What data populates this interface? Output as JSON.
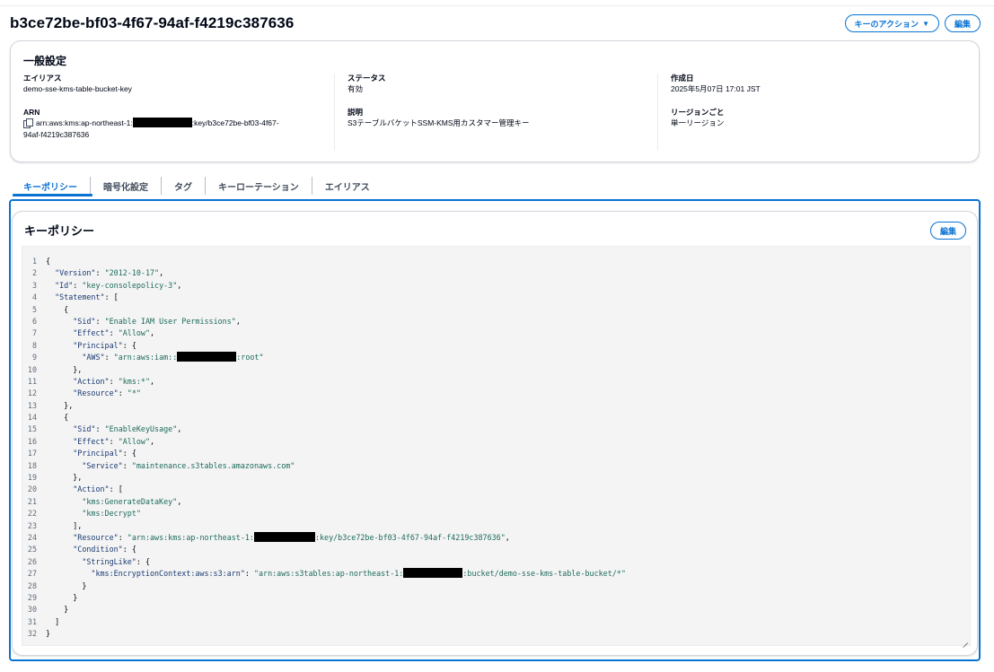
{
  "header": {
    "title": "b3ce72be-bf03-4f67-94af-f4219c387636",
    "key_actions_label": "キーのアクション",
    "edit_label": "編集"
  },
  "general": {
    "title": "一般設定",
    "alias_label": "エイリアス",
    "alias_value": "demo-sse-kms-table-bucket-key",
    "arn_label": "ARN",
    "arn_prefix": "arn:aws:kms:ap-northeast-1:",
    "arn_suffix": ":key/b3ce72be-bf03-4f67-",
    "arn_line2": "94af-f4219c387636",
    "status_label": "ステータス",
    "status_value": "有効",
    "description_label": "説明",
    "description_value": "S3テーブルバケットSSM-KMS用カスタマー管理キー",
    "created_label": "作成日",
    "created_value": "2025年5月07日 17:01 JST",
    "region_label": "リージョンごと",
    "region_value": "単一リージョン"
  },
  "tabs": [
    {
      "label": "キーポリシー",
      "active": true
    },
    {
      "label": "暗号化設定",
      "active": false
    },
    {
      "label": "タグ",
      "active": false
    },
    {
      "label": "キーローテーション",
      "active": false
    },
    {
      "label": "エイリアス",
      "active": false
    }
  ],
  "policy": {
    "title": "キーポリシー",
    "edit_label": "編集",
    "lines": [
      {
        "n": "1",
        "parts": [
          [
            "p",
            "{"
          ]
        ]
      },
      {
        "n": "2",
        "parts": [
          [
            "p",
            "  "
          ],
          [
            "k",
            "\"Version\""
          ],
          [
            "p",
            ": "
          ],
          [
            "s",
            "\"2012-10-17\""
          ],
          [
            "p",
            ","
          ]
        ]
      },
      {
        "n": "3",
        "parts": [
          [
            "p",
            "  "
          ],
          [
            "k",
            "\"Id\""
          ],
          [
            "p",
            ": "
          ],
          [
            "s",
            "\"key-consolepolicy-3\""
          ],
          [
            "p",
            ","
          ]
        ]
      },
      {
        "n": "4",
        "parts": [
          [
            "p",
            "  "
          ],
          [
            "k",
            "\"Statement\""
          ],
          [
            "p",
            ": ["
          ]
        ]
      },
      {
        "n": "5",
        "parts": [
          [
            "p",
            "    {"
          ]
        ]
      },
      {
        "n": "6",
        "parts": [
          [
            "p",
            "      "
          ],
          [
            "k",
            "\"Sid\""
          ],
          [
            "p",
            ": "
          ],
          [
            "s",
            "\"Enable IAM User Permissions\""
          ],
          [
            "p",
            ","
          ]
        ]
      },
      {
        "n": "7",
        "parts": [
          [
            "p",
            "      "
          ],
          [
            "k",
            "\"Effect\""
          ],
          [
            "p",
            ": "
          ],
          [
            "s",
            "\"Allow\""
          ],
          [
            "p",
            ","
          ]
        ]
      },
      {
        "n": "8",
        "parts": [
          [
            "p",
            "      "
          ],
          [
            "k",
            "\"Principal\""
          ],
          [
            "p",
            ": {"
          ]
        ]
      },
      {
        "n": "9",
        "parts": [
          [
            "p",
            "        "
          ],
          [
            "k",
            "\"AWS\""
          ],
          [
            "p",
            ": "
          ],
          [
            "s",
            "\"arn:aws:iam::"
          ],
          [
            "r",
            "11"
          ],
          [
            "s",
            ":root\""
          ]
        ]
      },
      {
        "n": "10",
        "parts": [
          [
            "p",
            "      },"
          ]
        ]
      },
      {
        "n": "11",
        "parts": [
          [
            "p",
            "      "
          ],
          [
            "k",
            "\"Action\""
          ],
          [
            "p",
            ": "
          ],
          [
            "s",
            "\"kms:*\""
          ],
          [
            "p",
            ","
          ]
        ]
      },
      {
        "n": "12",
        "parts": [
          [
            "p",
            "      "
          ],
          [
            "k",
            "\"Resource\""
          ],
          [
            "p",
            ": "
          ],
          [
            "s",
            "\"*\""
          ]
        ]
      },
      {
        "n": "13",
        "parts": [
          [
            "p",
            "    },"
          ]
        ]
      },
      {
        "n": "14",
        "parts": [
          [
            "p",
            "    {"
          ]
        ]
      },
      {
        "n": "15",
        "parts": [
          [
            "p",
            "      "
          ],
          [
            "k",
            "\"Sid\""
          ],
          [
            "p",
            ": "
          ],
          [
            "s",
            "\"EnableKeyUsage\""
          ],
          [
            "p",
            ","
          ]
        ]
      },
      {
        "n": "16",
        "parts": [
          [
            "p",
            "      "
          ],
          [
            "k",
            "\"Effect\""
          ],
          [
            "p",
            ": "
          ],
          [
            "s",
            "\"Allow\""
          ],
          [
            "p",
            ","
          ]
        ]
      },
      {
        "n": "17",
        "parts": [
          [
            "p",
            "      "
          ],
          [
            "k",
            "\"Principal\""
          ],
          [
            "p",
            ": {"
          ]
        ]
      },
      {
        "n": "18",
        "parts": [
          [
            "p",
            "        "
          ],
          [
            "k",
            "\"Service\""
          ],
          [
            "p",
            ": "
          ],
          [
            "s",
            "\"maintenance.s3tables.amazonaws.com\""
          ]
        ]
      },
      {
        "n": "19",
        "parts": [
          [
            "p",
            "      },"
          ]
        ]
      },
      {
        "n": "20",
        "parts": [
          [
            "p",
            "      "
          ],
          [
            "k",
            "\"Action\""
          ],
          [
            "p",
            ": ["
          ]
        ]
      },
      {
        "n": "21",
        "parts": [
          [
            "p",
            "        "
          ],
          [
            "s",
            "\"kms:GenerateDataKey\""
          ],
          [
            "p",
            ","
          ]
        ]
      },
      {
        "n": "22",
        "parts": [
          [
            "p",
            "        "
          ],
          [
            "s",
            "\"kms:Decrypt\""
          ]
        ]
      },
      {
        "n": "23",
        "parts": [
          [
            "p",
            "      ],"
          ]
        ]
      },
      {
        "n": "24",
        "parts": [
          [
            "p",
            "      "
          ],
          [
            "k",
            "\"Resource\""
          ],
          [
            "p",
            ": "
          ],
          [
            "s",
            "\"arn:aws:kms:ap-northeast-1:"
          ],
          [
            "r",
            "11"
          ],
          [
            "s",
            ":key/b3ce72be-bf03-4f67-94af-f4219c387636\""
          ],
          [
            "p",
            ","
          ]
        ]
      },
      {
        "n": "25",
        "parts": [
          [
            "p",
            "      "
          ],
          [
            "k",
            "\"Condition\""
          ],
          [
            "p",
            ": {"
          ]
        ]
      },
      {
        "n": "26",
        "parts": [
          [
            "p",
            "        "
          ],
          [
            "k",
            "\"StringLike\""
          ],
          [
            "p",
            ": {"
          ]
        ]
      },
      {
        "n": "27",
        "parts": [
          [
            "p",
            "          "
          ],
          [
            "k",
            "\"kms:EncryptionContext:aws:s3:arn\""
          ],
          [
            "p",
            ": "
          ],
          [
            "s",
            "\"arn:aws:s3tables:ap-northeast-1:"
          ],
          [
            "r",
            "11"
          ],
          [
            "s",
            ":bucket/demo-sse-kms-table-bucket/*\""
          ]
        ]
      },
      {
        "n": "28",
        "parts": [
          [
            "p",
            "        }"
          ]
        ]
      },
      {
        "n": "29",
        "parts": [
          [
            "p",
            "      }"
          ]
        ]
      },
      {
        "n": "30",
        "parts": [
          [
            "p",
            "    }"
          ]
        ]
      },
      {
        "n": "31",
        "parts": [
          [
            "p",
            "  ]"
          ]
        ]
      },
      {
        "n": "32",
        "parts": [
          [
            "p",
            "}"
          ]
        ]
      }
    ]
  },
  "colors": {
    "accent": "#0972d3",
    "text": "#000716",
    "json_key": "#1a3a72",
    "json_string": "#1d6b5b",
    "redaction": "#000000"
  }
}
